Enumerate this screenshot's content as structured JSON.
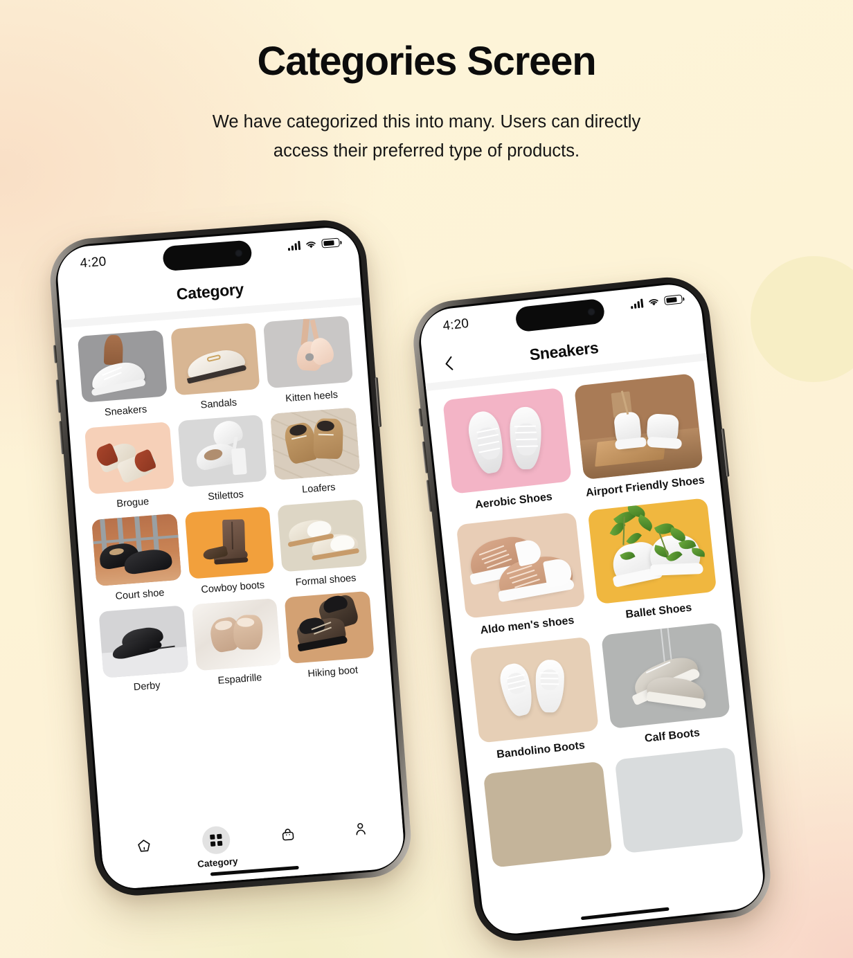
{
  "headline": {
    "title": "Categories Screen",
    "subtitle_line1": "We have categorized this into many. Users can directly",
    "subtitle_line2": "access their preferred type of products."
  },
  "colors": {
    "page_bg_top_left": "#fdf4d9",
    "page_bg_bottom_right": "#f8d4c6",
    "deco_circle": "#f6ecc2",
    "accent_orange": "#f2a03c",
    "accent_pink": "#f3b4c6",
    "accent_yellow": "#f0b73f",
    "text_primary": "#0b0b0b",
    "active_tab_chip": "#e2e2e2"
  },
  "phone_category": {
    "status_bar": {
      "time": "4:20",
      "signal_icon": "cellular-bars-icon",
      "wifi_icon": "wifi-icon",
      "battery_icon": "battery-icon",
      "battery_level": "72%"
    },
    "nav": {
      "title": "Category"
    },
    "categories": [
      {
        "label": "Sneakers",
        "bg": "#9a9a9c",
        "art": "sneaker-on-foot"
      },
      {
        "label": "Sandals",
        "bg": "#d8b693",
        "art": "loafer-mule"
      },
      {
        "label": "Kitten heels",
        "bg": "#c9c7c6",
        "art": "ballet-pointe"
      },
      {
        "label": "Brogue",
        "bg": "#f6d0b8",
        "art": "brown-mules"
      },
      {
        "label": "Stilettos",
        "bg": "#d8d8d8",
        "art": "white-stiletto"
      },
      {
        "label": "Loafers",
        "bg": "#cdbfae",
        "art": "tan-desert-boots"
      },
      {
        "label": "Court shoe",
        "bg": "#c1794e",
        "art": "black-oxford"
      },
      {
        "label": "Cowboy boots",
        "bg": "#f2a03c",
        "art": "cowboy-boot"
      },
      {
        "label": "Formal shoes",
        "bg": "#ddd6c5",
        "art": "cream-loafers"
      },
      {
        "label": "Derby",
        "bg": "#d4d4d6",
        "art": "black-jazz-shoe"
      },
      {
        "label": "Espadrille",
        "bg": "#ece7e3",
        "art": "beige-pumps"
      },
      {
        "label": "Hiking boot",
        "bg": "#d3a173",
        "art": "hiking-boots"
      }
    ],
    "tabbar": {
      "items": [
        {
          "label": "",
          "icon": "home-icon",
          "active": false
        },
        {
          "label": "Category",
          "icon": "grid-icon",
          "active": true
        },
        {
          "label": "",
          "icon": "bag-icon",
          "active": false
        },
        {
          "label": "",
          "icon": "person-icon",
          "active": false
        }
      ]
    }
  },
  "phone_sneakers": {
    "status_bar": {
      "time": "4:20",
      "signal_icon": "cellular-bars-icon",
      "wifi_icon": "wifi-icon",
      "battery_icon": "battery-icon",
      "battery_level": "72%"
    },
    "nav": {
      "title": "Sneakers",
      "back_icon": "chevron-left-icon"
    },
    "products": [
      {
        "label": "Aerobic Shoes",
        "bg": "#f3b4c6",
        "art": "white-sneakers-top"
      },
      {
        "label": "Airport Friendly Shoes",
        "bg": "#a97b56",
        "art": "white-hightops-box"
      },
      {
        "label": "Aldo men's shoes",
        "bg": "#e8cdb6",
        "art": "tan-canvas-sneakers"
      },
      {
        "label": "Ballet Shoes",
        "bg": "#f0b73f",
        "art": "plant-sneakers"
      },
      {
        "label": "Bandolino Boots",
        "bg": "#e6cfb6",
        "art": "white-baby-sneakers"
      },
      {
        "label": "Calf Boots",
        "bg": "#b3b5b4",
        "art": "grey-sneaker-hanging"
      },
      {
        "label": "",
        "bg": "#c4b49a",
        "art": "partial-tile"
      },
      {
        "label": "",
        "bg": "#d9dcdd",
        "art": "partial-tile"
      }
    ]
  }
}
